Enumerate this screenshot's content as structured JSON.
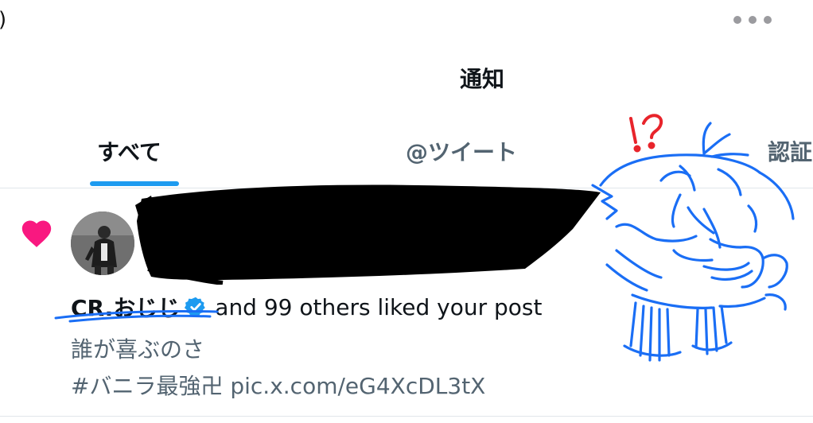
{
  "status_fragment": ")",
  "header": {
    "title": "通知"
  },
  "tabs": [
    {
      "label": "すべて",
      "active": true
    },
    {
      "label": "@ツイート",
      "active": false
    },
    {
      "label": "認証",
      "active": false
    }
  ],
  "notification": {
    "icon": "heart-icon",
    "icon_color": "#f91880",
    "user_name": "CR.おじじ",
    "verified": true,
    "liked_text": "and 99 others liked your post",
    "post_text": "誰が喜ぶのさ",
    "post_tag_and_link": "#バニラ最強卍 pic.x.com/eG4XcDL3tX"
  },
  "doodle": {
    "exclamation": "!?"
  },
  "colors": {
    "accent": "#1d9bf0",
    "like": "#f91880",
    "secondary_text": "#536471",
    "doodle_blue": "#1a6ef5",
    "doodle_red": "#e8242b"
  }
}
